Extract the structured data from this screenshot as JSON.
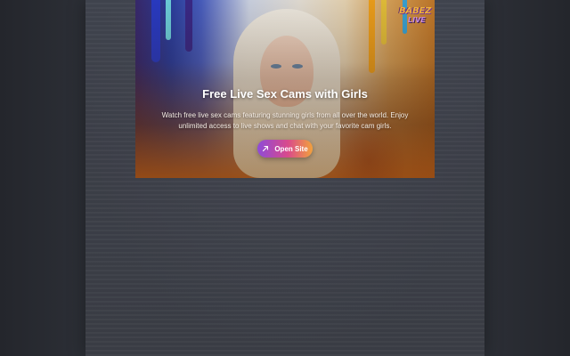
{
  "card": {
    "title": "Free Live Sex Cams with Girls",
    "description": "Watch free live sex cams featuring stunning girls from all over the world. Enjoy unlimited access to live shows and chat with your favorite cam girls.",
    "button": {
      "label": "Open Site",
      "icon": "arrow-up-right-icon"
    },
    "logo": {
      "line1": "BABEZ",
      "line2": "LIVE"
    }
  },
  "colors": {
    "page_background": "#2b2e35",
    "button_gradient_start": "#8e4bd8",
    "button_gradient_mid": "#d94a8c",
    "button_gradient_end": "#f2a13c",
    "title_text": "#ffffff"
  }
}
